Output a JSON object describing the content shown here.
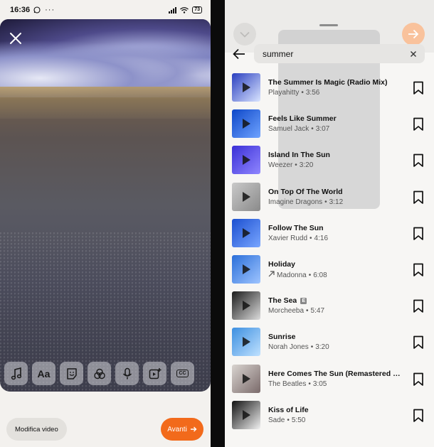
{
  "left": {
    "status": {
      "time": "16:36",
      "battery": "73"
    },
    "edit_button": "Modifica video",
    "next_button": "Avanti",
    "tools": [
      {
        "name": "music-tool",
        "icon": "music-note-icon",
        "text": ""
      },
      {
        "name": "text-tool",
        "icon": "text-icon",
        "text": "Aa"
      },
      {
        "name": "sticker-tool",
        "icon": "sticker-icon",
        "text": ""
      },
      {
        "name": "effects-tool",
        "icon": "effects-icon",
        "text": ""
      },
      {
        "name": "voice-tool",
        "icon": "microphone-icon",
        "text": ""
      },
      {
        "name": "clip-tool",
        "icon": "add-clip-icon",
        "text": ""
      },
      {
        "name": "captions-tool",
        "icon": "captions-icon",
        "text": "CC"
      }
    ],
    "accent": "#f26a1b"
  },
  "right": {
    "search": {
      "value": "summer",
      "placeholder": ""
    },
    "songs": [
      {
        "title": "The Summer Is Magic (Radio Mix)",
        "artist": "Playahitty",
        "duration": "3:56",
        "explicit": false,
        "trend": false,
        "cover": [
          "#2a3fbf",
          "#d9e4ff"
        ]
      },
      {
        "title": "Feels Like Summer",
        "artist": "Samuel Jack",
        "duration": "3:07",
        "explicit": false,
        "trend": false,
        "cover": [
          "#0d47c8",
          "#6fa3ff"
        ]
      },
      {
        "title": "Island In The Sun",
        "artist": "Weezer",
        "duration": "3:20",
        "explicit": false,
        "trend": false,
        "cover": [
          "#3a2fd6",
          "#8f86ff"
        ]
      },
      {
        "title": "On Top Of The World",
        "artist": "Imagine Dragons",
        "duration": "3:12",
        "explicit": false,
        "trend": false,
        "cover": [
          "#c9c9c9",
          "#8a8a8a"
        ]
      },
      {
        "title": "Follow The Sun",
        "artist": "Xavier Rudd",
        "duration": "4:16",
        "explicit": false,
        "trend": false,
        "cover": [
          "#1b4fd0",
          "#79a6ff"
        ]
      },
      {
        "title": "Holiday",
        "artist": "Madonna",
        "duration": "6:08",
        "explicit": false,
        "trend": true,
        "cover": [
          "#2b6fd9",
          "#9ec4ff"
        ]
      },
      {
        "title": "The Sea",
        "artist": "Morcheeba",
        "duration": "5:47",
        "explicit": true,
        "explicit_mark": "E",
        "trend": false,
        "cover": [
          "#1b1b1b",
          "#dcdcdc"
        ]
      },
      {
        "title": "Sunrise",
        "artist": "Norah Jones",
        "duration": "3:20",
        "explicit": false,
        "trend": false,
        "cover": [
          "#3d8fe0",
          "#bfe1ff"
        ]
      },
      {
        "title": "Here Comes The Sun (Remastered 20...",
        "artist": "The Beatles",
        "duration": "3:05",
        "explicit": false,
        "trend": false,
        "cover": [
          "#d9d4d0",
          "#7a6a6a"
        ]
      },
      {
        "title": "Kiss of Life",
        "artist": "Sade",
        "duration": "5:50",
        "explicit": false,
        "trend": false,
        "cover": [
          "#111111",
          "#f2f2f2"
        ]
      }
    ],
    "separator": "•"
  }
}
